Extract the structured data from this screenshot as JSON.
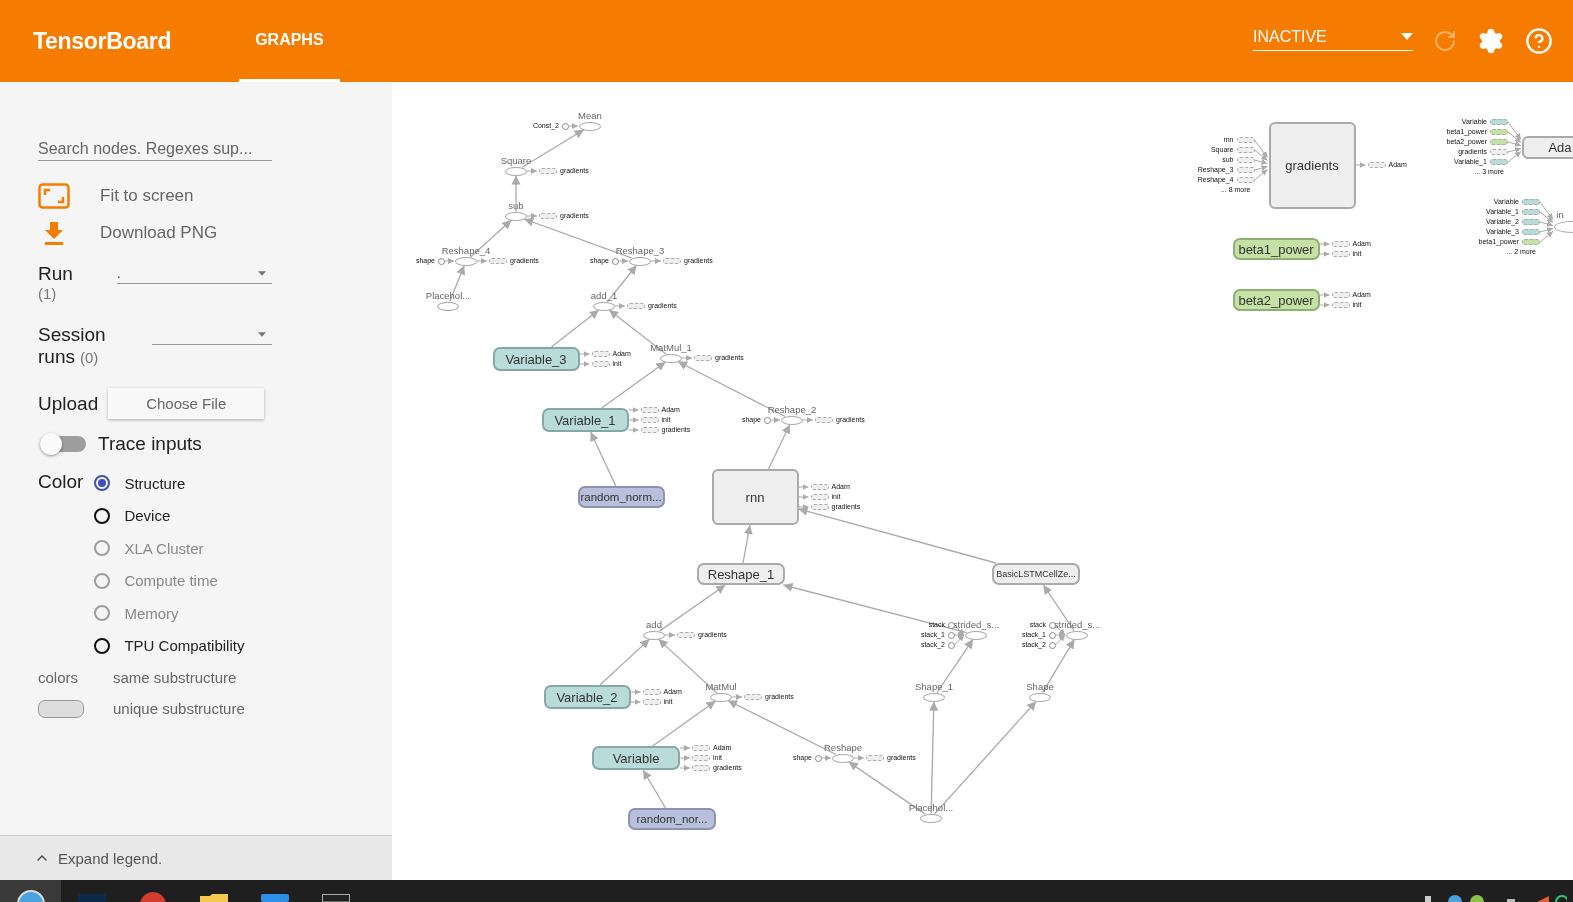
{
  "header": {
    "title": "TensorBoard",
    "tabs": [
      {
        "label": "GRAPHS",
        "selected": true
      }
    ],
    "run_status": "INACTIVE"
  },
  "sidebar": {
    "search": {
      "placeholder": "Search nodes. Regexes sup..."
    },
    "actions": [
      "Fit to screen",
      "Download PNG"
    ],
    "run": {
      "label": "Run",
      "count": "(1)",
      "value": "."
    },
    "session_runs": {
      "label_1": "Session",
      "label_2": "runs",
      "count": "(0)"
    },
    "upload": {
      "label": "Upload",
      "button": "Choose File"
    },
    "trace": {
      "label": "Trace inputs",
      "on": false
    },
    "color": {
      "label": "Color",
      "options": [
        {
          "label": "Structure",
          "selected": true,
          "disabled": false
        },
        {
          "label": "Device",
          "selected": false,
          "disabled": false
        },
        {
          "label": "XLA Cluster",
          "selected": false,
          "disabled": true
        },
        {
          "label": "Compute time",
          "selected": false,
          "disabled": true
        },
        {
          "label": "Memory",
          "selected": false,
          "disabled": true
        },
        {
          "label": "TPU Compatibility",
          "selected": false,
          "disabled": false
        }
      ]
    },
    "legend": {
      "label": "colors",
      "rows": [
        "same substructure",
        "unique substructure"
      ]
    },
    "expand": "Expand legend."
  },
  "graph": {
    "nodes": [
      {
        "label": "Mean",
        "kind": "op",
        "inputs": [
          "Const_2"
        ]
      },
      {
        "label": "Square",
        "kind": "op",
        "outputs": [
          "gradients"
        ]
      },
      {
        "label": "sub",
        "kind": "op",
        "outputs": [
          "gradients"
        ]
      },
      {
        "label": "Reshape_4",
        "kind": "op",
        "inputs": [
          "shape"
        ],
        "outputs": [
          "gradients"
        ]
      },
      {
        "label": "Placehol...",
        "kind": "op"
      },
      {
        "label": "Reshape_3",
        "kind": "op",
        "inputs": [
          "shape"
        ],
        "outputs": [
          "gradients"
        ]
      },
      {
        "label": "add_1",
        "kind": "op",
        "outputs": [
          "gradients"
        ]
      },
      {
        "label": "Variable_3",
        "kind": "variable",
        "outputs": [
          "Adam",
          "init"
        ]
      },
      {
        "label": "MatMul_1",
        "kind": "op",
        "outputs": [
          "gradients"
        ]
      },
      {
        "label": "Variable_1",
        "kind": "variable",
        "outputs": [
          "Adam",
          "init",
          "gradients"
        ]
      },
      {
        "label": "Reshape_2",
        "kind": "op",
        "inputs": [
          "shape"
        ],
        "outputs": [
          "gradients"
        ]
      },
      {
        "label": "random_norm...",
        "kind": "random"
      },
      {
        "label": "rnn",
        "kind": "group",
        "outputs": [
          "Adam",
          "init",
          "gradients"
        ]
      },
      {
        "label": "Reshape_1",
        "kind": "meta"
      },
      {
        "label": "BasicLSTMCellZe...",
        "kind": "meta"
      },
      {
        "label": "add",
        "kind": "op",
        "outputs": [
          "gradients"
        ]
      },
      {
        "label": "strided_s...",
        "kind": "op",
        "inputs": [
          "stack",
          "stack_1",
          "stack_2"
        ]
      },
      {
        "label": "strided_s...",
        "kind": "op",
        "inputs": [
          "stack",
          "stack_1",
          "stack_2"
        ]
      },
      {
        "label": "Variable_2",
        "kind": "variable",
        "outputs": [
          "Adam",
          "init"
        ]
      },
      {
        "label": "MatMul",
        "kind": "op",
        "outputs": [
          "gradients"
        ]
      },
      {
        "label": "Shape_1",
        "kind": "op"
      },
      {
        "label": "Shape",
        "kind": "op"
      },
      {
        "label": "Variable",
        "kind": "variable",
        "outputs": [
          "Adam",
          "init",
          "gradients"
        ]
      },
      {
        "label": "Reshape",
        "kind": "op",
        "inputs": [
          "shape"
        ],
        "outputs": [
          "gradients"
        ]
      },
      {
        "label": "random_nor...",
        "kind": "random"
      },
      {
        "label": "Placehol...",
        "kind": "op"
      },
      {
        "label": "gradients",
        "kind": "group",
        "tensor_inputs": [
          {
            "label": "rnn",
            "color": "#eeeeee"
          },
          {
            "label": "Square",
            "color": "#eeeeee"
          },
          {
            "label": "sub",
            "color": "#eeeeee"
          },
          {
            "label": "Reshape_3",
            "color": "#eeeeee"
          },
          {
            "label": "Reshape_4",
            "color": "#eeeeee"
          }
        ],
        "more": "... 8 more",
        "outputs": [
          "Adam"
        ]
      },
      {
        "label": "beta1_power",
        "kind": "power",
        "outputs": [
          "Adam",
          "init"
        ]
      },
      {
        "label": "beta2_power",
        "kind": "power",
        "outputs": [
          "Adam",
          "init"
        ]
      },
      {
        "label": "Ada",
        "kind": "group",
        "tensor_inputs": [
          {
            "label": "Variable",
            "color": "#b9dbd9"
          },
          {
            "label": "beta1_power",
            "color": "#c5e1a5"
          },
          {
            "label": "beta2_power",
            "color": "#c5e1a5"
          },
          {
            "label": "gradients",
            "color": "#eeeeee"
          },
          {
            "label": "Variable_1",
            "color": "#b9dbd9"
          }
        ],
        "more": "... 3 more"
      },
      {
        "label": "in",
        "kind": "op",
        "tensor_inputs": [
          {
            "label": "Variable",
            "color": "#b9dbd9"
          },
          {
            "label": "Variable_1",
            "color": "#b9dbd9"
          },
          {
            "label": "Variable_2",
            "color": "#b9dbd9"
          },
          {
            "label": "Variable_3",
            "color": "#b9dbd9"
          },
          {
            "label": "beta1_power",
            "color": "#c5e1a5"
          }
        ],
        "more": "... 2 more"
      }
    ]
  }
}
